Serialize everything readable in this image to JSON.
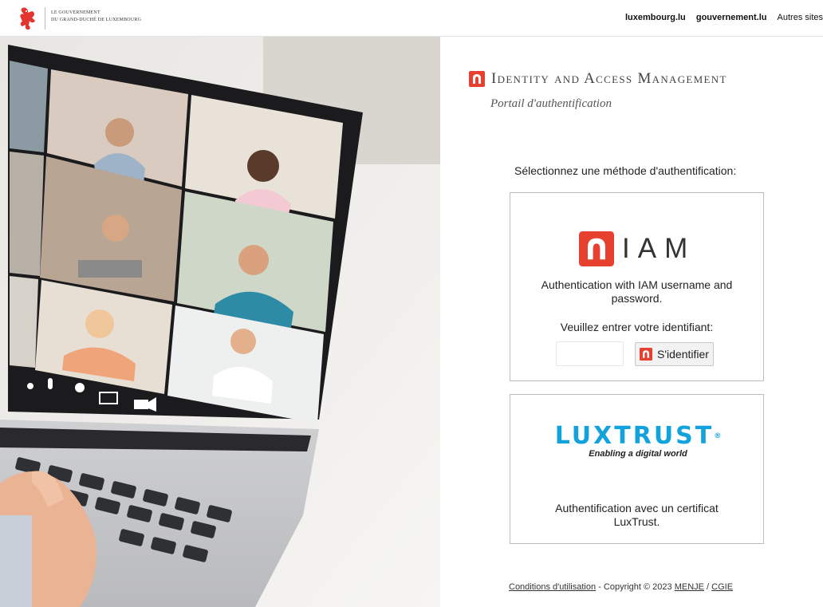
{
  "header": {
    "gov_line1": "Le Gouvernement",
    "gov_line2": "du Grand-Duché de Luxembourg",
    "links": [
      "luxembourg.lu",
      "gouvernement.lu",
      "Autres sites"
    ]
  },
  "hero": {
    "icons": [
      "speaker-icon",
      "microphone-icon",
      "participants-icon",
      "screen-share-icon",
      "camera-icon"
    ]
  },
  "iam": {
    "title": "Identity and Access Management",
    "subtitle": "Portail d'authentification"
  },
  "method_title": "Sélectionnez une méthode d'authentification:",
  "iam_card": {
    "logo_word": "IAM",
    "description": "Authentication with IAM username and password.",
    "prompt": "Veuillez entrer votre identifiant:",
    "input_value": "",
    "button_label": "S'identifier"
  },
  "luxtrust_card": {
    "logo_word": "LUXTRUST",
    "logo_mark": "®",
    "tagline": "Enabling a digital world",
    "description": "Authentification avec un certificat LuxTrust."
  },
  "footer": {
    "conditions": "Conditions d'utilisation",
    "copyright": " - Copyright © 2023 ",
    "menje": "MENJE",
    "slash": " / ",
    "cgie": "CGIE"
  },
  "colors": {
    "iam_red": "#e8402e",
    "luxtrust_blue": "#12a3dc",
    "border": "#bdbdbd"
  }
}
